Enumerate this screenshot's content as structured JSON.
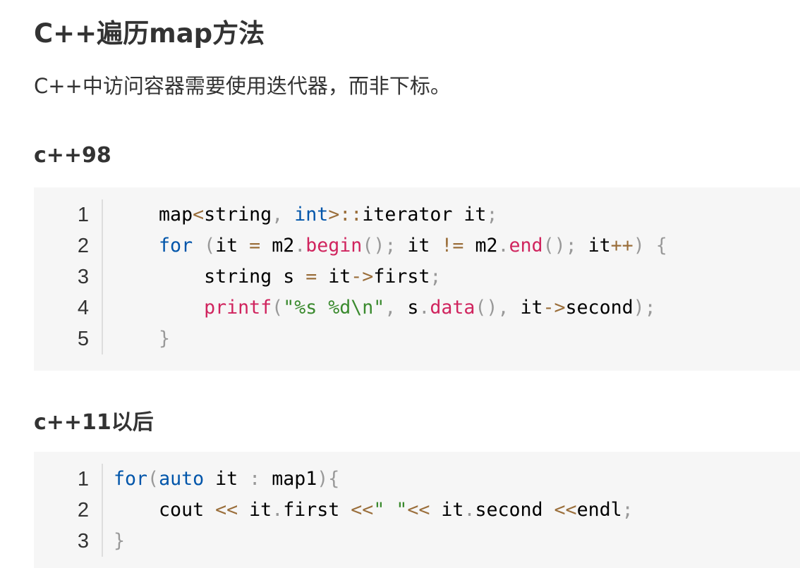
{
  "title": "C++遍历map方法",
  "intro": "C++中访问容器需要使用迭代器，而非下标。",
  "sections": [
    {
      "heading": "c++98",
      "line_numbers": [
        "1",
        "2",
        "3",
        "4",
        "5"
      ],
      "code_lines": [
        "    map<string, int>::iterator it;",
        "    for (it = m2.begin(); it != m2.end(); it++) {",
        "        string s = it->first;",
        "        printf(\"%s %d\\n\", s.data(), it->second);",
        "    }"
      ]
    },
    {
      "heading": "c++11以后",
      "line_numbers": [
        "1",
        "2",
        "3"
      ],
      "code_lines": [
        "for(auto it : map1){",
        "    cout << it.first <<\" \"<< it.second <<endl;",
        "}"
      ]
    }
  ],
  "syntax_colors": {
    "keyword": "#0055aa",
    "function": "#d0245e",
    "string": "#3a8a2e",
    "operator": "#9a6e3a",
    "punctuation": "#999999",
    "code_background": "#f6f6f6"
  }
}
